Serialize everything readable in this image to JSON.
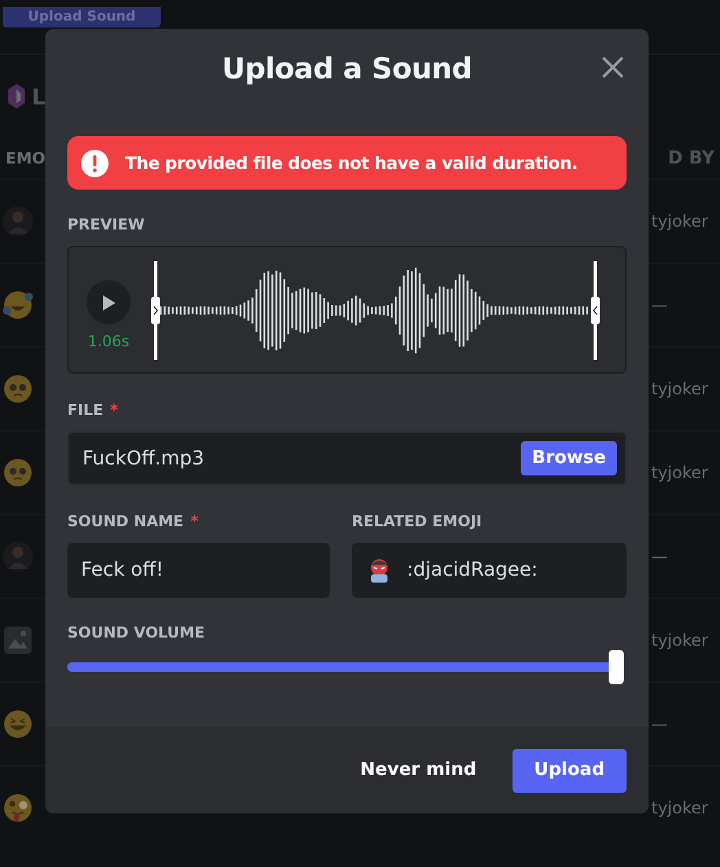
{
  "background": {
    "top_button": "Upload Sound",
    "server_initial": "L",
    "header_left": "EMO",
    "header_right": "D BY",
    "rows": [
      {
        "kind": "avatar",
        "uploader": "tyjoker"
      },
      {
        "kind": "laughing",
        "uploader": "—"
      },
      {
        "kind": "pleading",
        "uploader": "tyjoker"
      },
      {
        "kind": "pleading",
        "uploader": "tyjoker"
      },
      {
        "kind": "avatar",
        "uploader": "—"
      },
      {
        "kind": "image",
        "uploader": "tyjoker"
      },
      {
        "kind": "grinning",
        "uploader": "—"
      },
      {
        "kind": "zany",
        "uploader": "tyjoker"
      }
    ]
  },
  "modal": {
    "title": "Upload a Sound",
    "error": "The provided file does not have a valid duration.",
    "preview": {
      "label": "PREVIEW",
      "time": "1.06s"
    },
    "file": {
      "label": "FILE",
      "required_mark": "*",
      "value": "FuckOff.mp3",
      "button": "Browse"
    },
    "sound_name": {
      "label": "SOUND NAME",
      "required_mark": "*",
      "value": "Feck off!"
    },
    "related_emoji": {
      "label": "RELATED EMOJI",
      "value": ":djacidRagee:"
    },
    "volume": {
      "label": "SOUND VOLUME",
      "level": 1
    },
    "buttons": [
      {
        "kind": "link",
        "label": "Never mind"
      },
      {
        "kind": "primary",
        "label": "Upload"
      }
    ]
  }
}
